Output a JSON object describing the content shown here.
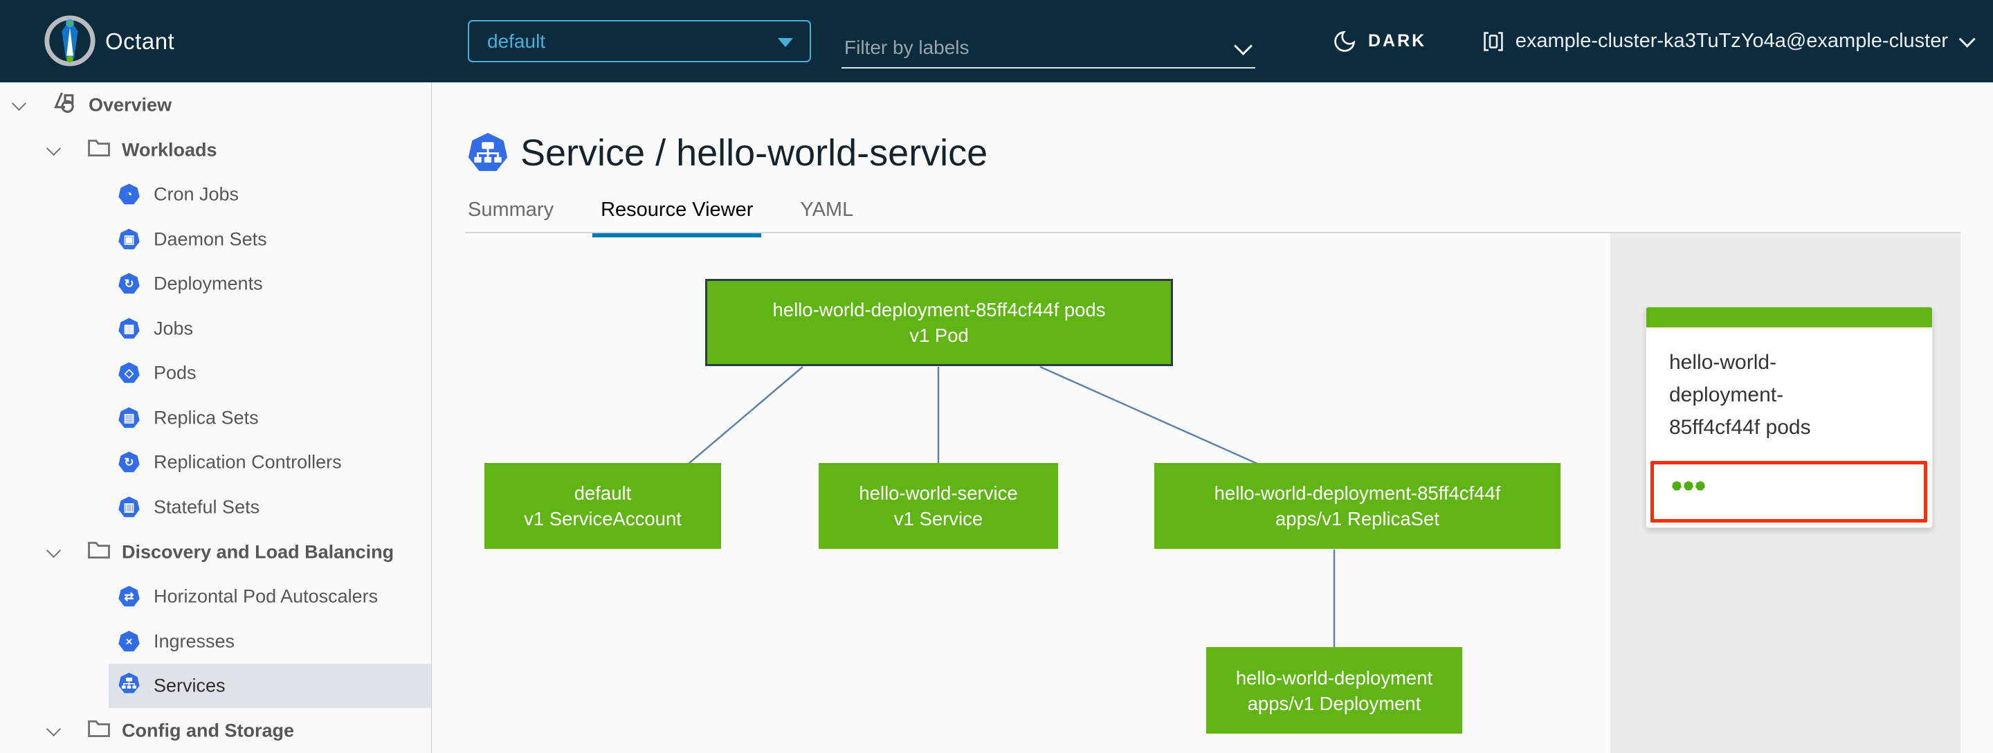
{
  "header": {
    "app_title": "Octant",
    "logo_icon": "octant-logo",
    "namespace_dropdown": {
      "value": "default",
      "caret_icon": "caret-down-icon"
    },
    "filter": {
      "placeholder": "Filter by labels",
      "chevron_icon": "chevron-down-icon"
    },
    "theme_toggle": {
      "label": "DARK",
      "icon": "moon-icon"
    },
    "context": {
      "label": "example-cluster-ka3TuTzYo4a@example-cluster",
      "icon": "cluster-icon",
      "chevron_icon": "chevron-down-icon"
    }
  },
  "sidebar": {
    "items": [
      {
        "label": "Overview",
        "icon": "overview-icon",
        "level": 0,
        "expanded": true,
        "selected": false
      },
      {
        "label": "Workloads",
        "icon": "folder-icon",
        "level": 1,
        "expanded": true,
        "selected": false
      },
      {
        "label": "Cron Jobs",
        "icon": "cron-jobs-icon",
        "level": 2,
        "selected": false
      },
      {
        "label": "Daemon Sets",
        "icon": "daemon-sets-icon",
        "level": 2,
        "selected": false
      },
      {
        "label": "Deployments",
        "icon": "deployments-icon",
        "level": 2,
        "selected": false
      },
      {
        "label": "Jobs",
        "icon": "jobs-icon",
        "level": 2,
        "selected": false
      },
      {
        "label": "Pods",
        "icon": "pods-icon",
        "level": 2,
        "selected": false
      },
      {
        "label": "Replica Sets",
        "icon": "replica-sets-icon",
        "level": 2,
        "selected": false
      },
      {
        "label": "Replication Controllers",
        "icon": "replication-controllers-icon",
        "level": 2,
        "selected": false
      },
      {
        "label": "Stateful Sets",
        "icon": "stateful-sets-icon",
        "level": 2,
        "selected": false
      },
      {
        "label": "Discovery and Load Balancing",
        "icon": "folder-icon",
        "level": 1,
        "expanded": true,
        "selected": false
      },
      {
        "label": "Horizontal Pod Autoscalers",
        "icon": "horizontal-pod-autoscalers-icon",
        "level": 2,
        "selected": false
      },
      {
        "label": "Ingresses",
        "icon": "ingresses-icon",
        "level": 2,
        "selected": false
      },
      {
        "label": "Services",
        "icon": "services-icon",
        "level": 2,
        "selected": true
      },
      {
        "label": "Config and Storage",
        "icon": "folder-icon",
        "level": 1,
        "expanded": true,
        "selected": false
      }
    ],
    "icon_glyphs": {
      "cron": "◔",
      "daemon": "▣",
      "deploy": "↻",
      "jobs": "▦",
      "pods": "◇",
      "replica": "▤",
      "repctrl": "↻",
      "stateful": "▥",
      "hpa": "⇄",
      "ingress": "×"
    }
  },
  "main": {
    "title": "Service / hello-world-service",
    "title_icon": "service-icon",
    "tabs": [
      {
        "label": "Summary",
        "active": false
      },
      {
        "label": "Resource Viewer",
        "active": true
      },
      {
        "label": "YAML",
        "active": false
      }
    ]
  },
  "graph": {
    "nodes": [
      {
        "id": "pod",
        "title": "hello-world-deployment-85ff4cf44f pods",
        "subtitle": "v1 Pod",
        "selected": true
      },
      {
        "id": "serviceaccount",
        "title": "default",
        "subtitle": "v1 ServiceAccount",
        "selected": false
      },
      {
        "id": "service",
        "title": "hello-world-service",
        "subtitle": "v1 Service",
        "selected": false
      },
      {
        "id": "replicaset",
        "title": "hello-world-deployment-85ff4cf44f",
        "subtitle": "apps/v1 ReplicaSet",
        "selected": false
      },
      {
        "id": "deployment",
        "title": "hello-world-deployment",
        "subtitle": "apps/v1 Deployment",
        "selected": false
      }
    ],
    "edges": [
      {
        "from": "pod",
        "to": "serviceaccount"
      },
      {
        "from": "pod",
        "to": "service"
      },
      {
        "from": "pod",
        "to": "replicaset"
      },
      {
        "from": "replicaset",
        "to": "deployment"
      }
    ]
  },
  "detail_panel": {
    "card": {
      "title": "hello-world-deployment-85ff4cf44f pods",
      "title_lines": [
        "hello-world-",
        "deployment-",
        "85ff4cf44f pods"
      ],
      "status_dots": 3,
      "highlighted": true
    }
  },
  "colors": {
    "header_bg": "#0c2c3e",
    "accent_blue": "#49afd9",
    "k8s_blue": "#326de6",
    "node_green": "#60b515",
    "edge_blue": "#5e82a8",
    "tab_active_blue": "#0079b8",
    "highlight_red": "#f4300b",
    "selected_row_bg": "#dde3e8",
    "panel_bg": "#ececec"
  }
}
